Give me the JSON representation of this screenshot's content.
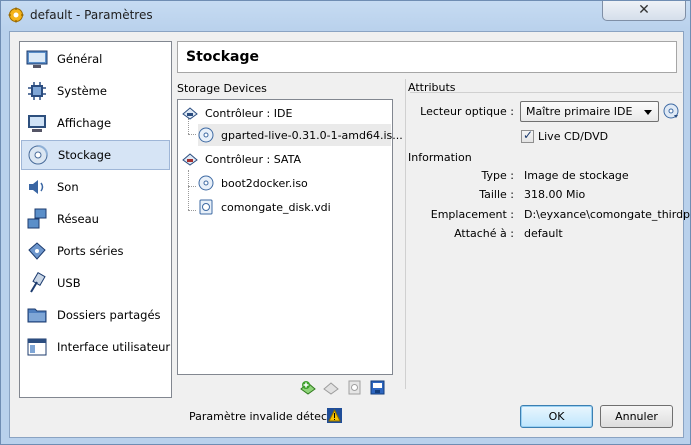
{
  "window": {
    "title": "default - Paramètres",
    "close_glyph": "✕"
  },
  "sidebar": {
    "items": [
      {
        "label": "Général",
        "icon": "monitor-icon"
      },
      {
        "label": "Système",
        "icon": "chip-icon"
      },
      {
        "label": "Affichage",
        "icon": "display-icon"
      },
      {
        "label": "Stockage",
        "icon": "disk-icon",
        "active": true
      },
      {
        "label": "Son",
        "icon": "speaker-icon"
      },
      {
        "label": "Réseau",
        "icon": "network-icon"
      },
      {
        "label": "Ports séries",
        "icon": "serial-port-icon"
      },
      {
        "label": "USB",
        "icon": "usb-icon"
      },
      {
        "label": "Dossiers partagés",
        "icon": "folder-icon"
      },
      {
        "label": "Interface utilisateur",
        "icon": "ui-window-icon"
      }
    ]
  },
  "page": {
    "title": "Stockage"
  },
  "storage": {
    "label": "Storage Devices",
    "controllers": [
      {
        "label": "Contrôleur : IDE",
        "devices": [
          {
            "label": "gparted-live-0.31.0-1-amd64.is...",
            "type": "optical",
            "selected": true
          }
        ]
      },
      {
        "label": "Contrôleur : SATA",
        "devices": [
          {
            "label": "boot2docker.iso",
            "type": "optical"
          },
          {
            "label": "comongate_disk.vdi",
            "type": "hard-disk"
          }
        ]
      }
    ]
  },
  "attributes": {
    "label": "Attributs",
    "optical_drive_label": "Lecteur optique :",
    "optical_drive_value": "Maître primaire IDE",
    "live_cd_label": "Live CD/DVD",
    "live_cd_checked": true
  },
  "information": {
    "label": "Information",
    "rows": [
      {
        "label": "Type :",
        "value": "Image de stockage"
      },
      {
        "label": "Taille :",
        "value": "318.00 Mio"
      },
      {
        "label": "Emplacement :",
        "value": "D:\\eyxance\\comongate_thirdp..."
      },
      {
        "label": "Attaché à :",
        "value": "default"
      }
    ]
  },
  "footer": {
    "warning": "Paramètre invalide détecté",
    "ok_label": "OK",
    "cancel_label": "Annuler"
  },
  "colors": {
    "accent": "#3c7fb1",
    "selection": "#d6e4f5"
  }
}
